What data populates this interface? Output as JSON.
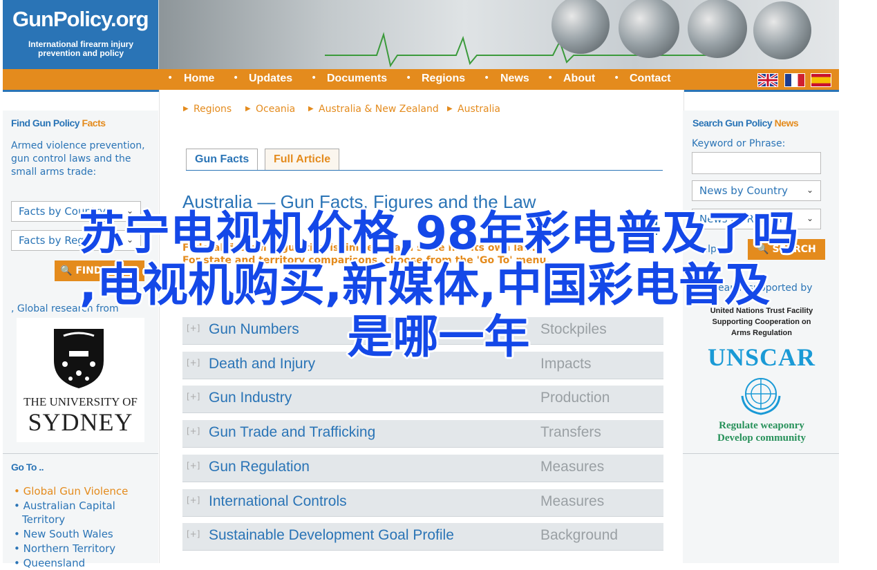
{
  "logo": {
    "title": "GunPolicy.org",
    "subtitle": "International firearm injury prevention and policy"
  },
  "nav": {
    "items": [
      "Home",
      "Updates",
      "Documents",
      "Regions",
      "News",
      "About",
      "Contact"
    ],
    "flags": [
      "uk-flag-icon",
      "france-flag-icon",
      "spain-flag-icon"
    ]
  },
  "left": {
    "title_a": "Find Gun Policy",
    "title_b": "Facts",
    "desc": "Armed violence prevention, gun control laws and the small arms trade:",
    "select1": "Facts by Country",
    "select2": "Facts by Region",
    "find_button": "FIND FACTS",
    "research_text": "Global research from",
    "university_line1": "THE UNIVERSITY OF",
    "university_line2": "SYDNEY",
    "goto_title": "Go To ..",
    "goto_items": [
      "Global Gun Violence",
      "Australian Capital Territory",
      "New South Wales",
      "Northern Territory",
      "Queensland"
    ]
  },
  "main": {
    "breadcrumbs": [
      "Regions",
      "Oceania",
      "Australia & New Zealand",
      "Australia"
    ],
    "tabs": [
      "Gun Facts",
      "Full Article"
    ],
    "title": "Australia — Gun Facts, Figures and the Law",
    "note_line1": "Federal firearm regulation is limited; each state has its own law.",
    "note_line2": "For state and territory comparisons, choose from the 'Go To' menu.",
    "sections": [
      {
        "title": "Gun Numbers",
        "category": "Stockpiles"
      },
      {
        "title": "Death and Injury",
        "category": "Impacts"
      },
      {
        "title": "Gun Industry",
        "category": "Production"
      },
      {
        "title": "Gun Trade and Trafficking",
        "category": "Transfers"
      },
      {
        "title": "Gun Regulation",
        "category": "Measures"
      },
      {
        "title": "International Controls",
        "category": "Measures"
      },
      {
        "title": "Sustainable Development Goal Profile",
        "category": "Background"
      }
    ]
  },
  "right": {
    "title_a": "Search Gun Policy",
    "title_b": "News",
    "keyword_label": "Keyword or Phrase:",
    "keyword_value": "",
    "select1": "News by Country",
    "select2": "News by Region",
    "help": "Help",
    "search_button": "SEARCH",
    "supported": "Research supported by",
    "unscar_line1": "United Nations Trust Facility",
    "unscar_line2": "Supporting Cooperation on",
    "unscar_line3": "Arms Regulation",
    "unscar": "UNSCAR",
    "slogan1": "Regulate weaponry",
    "slogan2": "Develop community"
  },
  "overlay": {
    "line1": "苏宁电视机价格,98年彩电普及了吗",
    "line2": ",电视机购买,新媒体,中国彩电普及",
    "line3": "是哪一年"
  },
  "colors": {
    "brand_blue": "#2a74b6",
    "brand_orange": "#e48b1d",
    "overlay_blue": "#1448e8"
  }
}
